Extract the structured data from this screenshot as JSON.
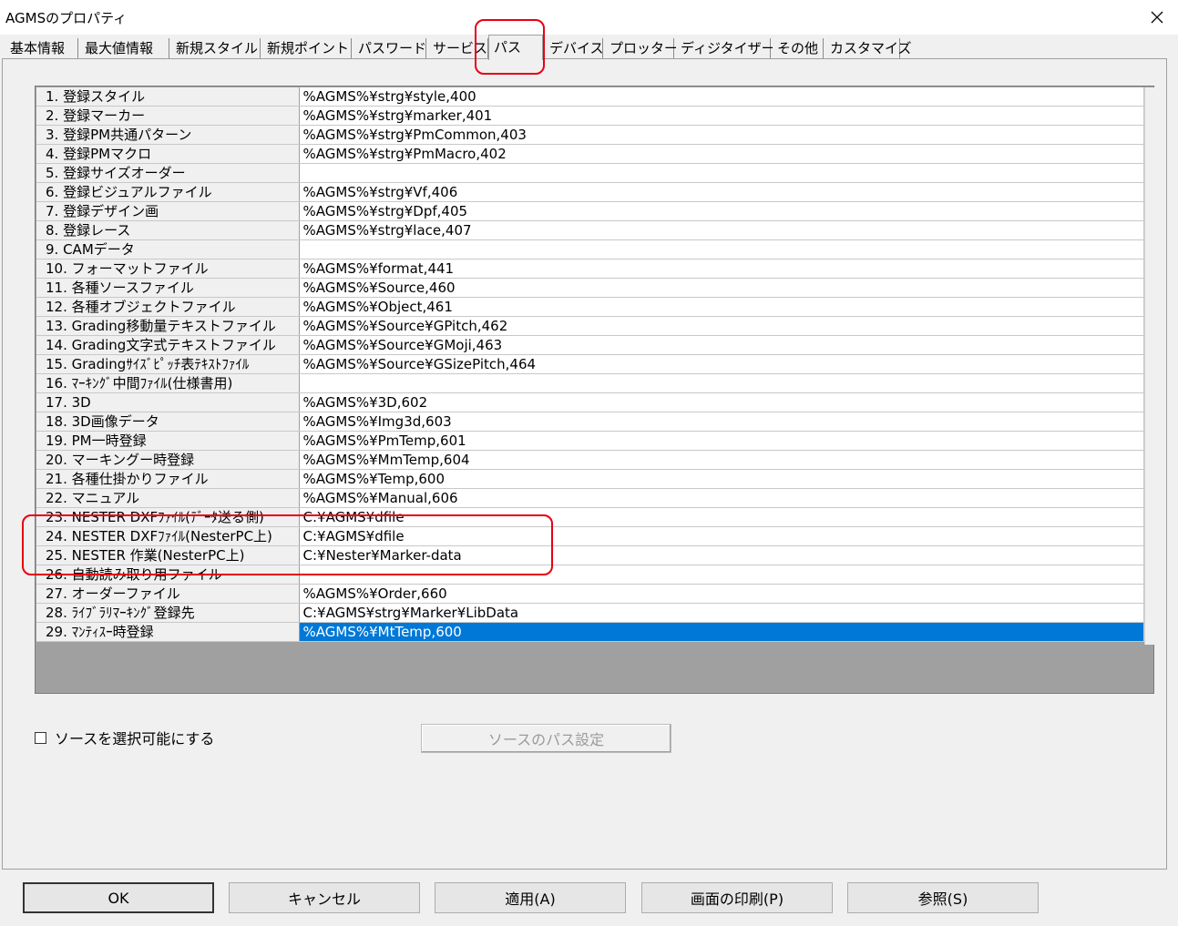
{
  "window": {
    "title": "AGMSのプロパティ"
  },
  "tabs": [
    {
      "label": "基本情報"
    },
    {
      "label": "最大値情報"
    },
    {
      "label": "新規スタイル"
    },
    {
      "label": "新規ポイント"
    },
    {
      "label": "パスワード"
    },
    {
      "label": "サービス"
    },
    {
      "label": "パス",
      "active": true
    },
    {
      "label": "デバイス"
    },
    {
      "label": "プロッター"
    },
    {
      "label": "ディジタイザー"
    },
    {
      "label": "その他"
    },
    {
      "label": "カスタマイズ"
    }
  ],
  "path_grid": {
    "rows": [
      {
        "label": "1. 登録スタイル",
        "value": "%AGMS%¥strg¥style,400"
      },
      {
        "label": "2. 登録マーカー",
        "value": "%AGMS%¥strg¥marker,401"
      },
      {
        "label": "3. 登録PM共通パターン",
        "value": "%AGMS%¥strg¥PmCommon,403"
      },
      {
        "label": "4. 登録PMマクロ",
        "value": "%AGMS%¥strg¥PmMacro,402"
      },
      {
        "label": "5. 登録サイズオーダー",
        "value": ""
      },
      {
        "label": "6. 登録ビジュアルファイル",
        "value": "%AGMS%¥strg¥Vf,406"
      },
      {
        "label": "7. 登録デザイン画",
        "value": "%AGMS%¥strg¥Dpf,405"
      },
      {
        "label": "8. 登録レース",
        "value": "%AGMS%¥strg¥lace,407"
      },
      {
        "label": "9. CAMデータ",
        "value": ""
      },
      {
        "label": "10. フォーマットファイル",
        "value": "%AGMS%¥format,441"
      },
      {
        "label": "11. 各種ソースファイル",
        "value": "%AGMS%¥Source,460"
      },
      {
        "label": "12. 各種オブジェクトファイル",
        "value": "%AGMS%¥Object,461"
      },
      {
        "label": "13. Grading移動量テキストファイル",
        "value": "%AGMS%¥Source¥GPitch,462"
      },
      {
        "label": "14. Grading文字式テキストファイル",
        "value": "%AGMS%¥Source¥GMoji,463"
      },
      {
        "label": "15. Gradingｻｲｽﾞﾋﾟｯﾁ表ﾃｷｽﾄﾌｧｲﾙ",
        "value": "%AGMS%¥Source¥GSizePitch,464"
      },
      {
        "label": "16. ﾏｰｷﾝｸﾞ中間ﾌｧｲﾙ(仕様書用)",
        "value": ""
      },
      {
        "label": "17. 3D",
        "value": "%AGMS%¥3D,602"
      },
      {
        "label": "18. 3D画像データ",
        "value": "%AGMS%¥Img3d,603"
      },
      {
        "label": "19. PM一時登録",
        "value": "%AGMS%¥PmTemp,601"
      },
      {
        "label": "20. マーキングー時登録",
        "value": "%AGMS%¥MmTemp,604"
      },
      {
        "label": "21. 各種仕掛かりファイル",
        "value": "%AGMS%¥Temp,600"
      },
      {
        "label": "22. マニュアル",
        "value": "%AGMS%¥Manual,606"
      },
      {
        "label": "23. NESTER DXFﾌｧｲﾙ(ﾃﾞｰﾀ送る側)",
        "value": "C:¥AGMS¥dfile"
      },
      {
        "label": "24. NESTER DXFﾌｧｲﾙ(NesterPC上)",
        "value": "C:¥AGMS¥dfile"
      },
      {
        "label": "25. NESTER 作業(NesterPC上)",
        "value": "C:¥Nester¥Marker-data"
      },
      {
        "label": "26. 自動読み取り用ファイル",
        "value": ""
      },
      {
        "label": "27. オーダーファイル",
        "value": "%AGMS%¥Order,660"
      },
      {
        "label": "28. ﾗｲﾌﾞﾗﾘﾏｰｷﾝｸﾞ登録先",
        "value": "C:¥AGMS¥strg¥Marker¥LibData"
      },
      {
        "label": "29. ﾏﾝﾃｨｽｰ時登録",
        "value": "%AGMS%¥MtTemp,600",
        "selected": true
      }
    ]
  },
  "source_select": {
    "checkbox_label": "ソースを選択可能にする",
    "checked": false
  },
  "source_path_button": {
    "label": "ソースのパス設定",
    "disabled": true
  },
  "footer": {
    "ok": "OK",
    "cancel": "キャンセル",
    "apply": "適用(A)",
    "print": "画面の印刷(P)",
    "browse": "参照(S)"
  },
  "colors": {
    "selection": "#0078d7",
    "annotation": "#e60012"
  }
}
